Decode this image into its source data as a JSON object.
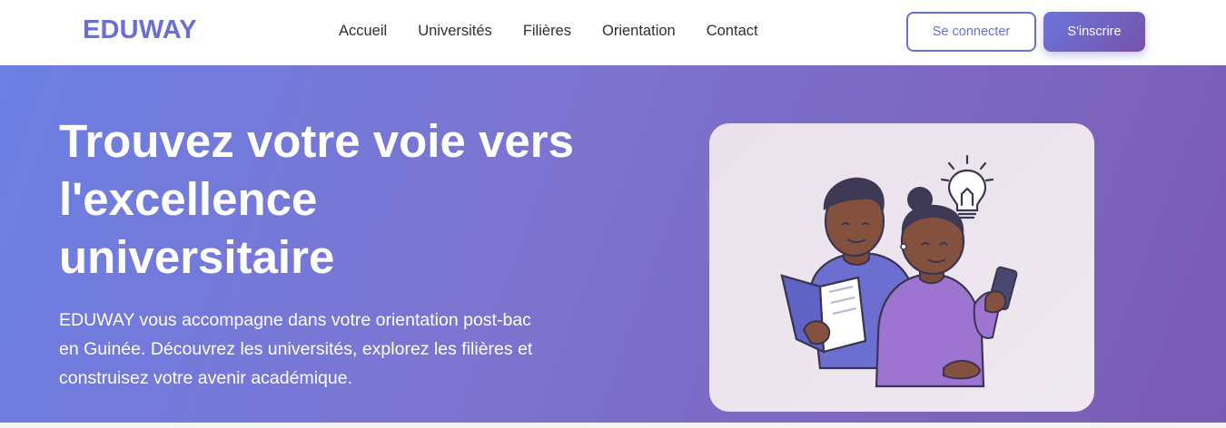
{
  "brand": {
    "name": "EDUWAY"
  },
  "nav": {
    "links": [
      "Accueil",
      "Universités",
      "Filières",
      "Orientation",
      "Contact"
    ]
  },
  "auth": {
    "login_label": "Se connecter",
    "signup_label": "S'inscrire"
  },
  "hero": {
    "title_lines": [
      "Trouvez votre voie vers",
      "l'excellence",
      "universitaire"
    ],
    "description_lines": [
      "EDUWAY vous accompagne dans votre orientation post-bac",
      "en Guinée. Découvrez les universités, explorez les filières et",
      "construisez votre avenir académique."
    ],
    "illustration": "students-reading-book-and-phone-with-lightbulb"
  },
  "colors": {
    "brand": "#6a6fd2",
    "hero_gradient_start": "#6c7fe3",
    "hero_gradient_end": "#7a5bb3",
    "nav_text": "#2e2e38"
  }
}
